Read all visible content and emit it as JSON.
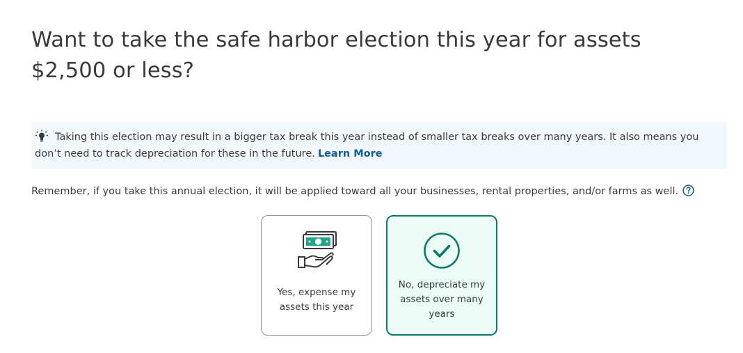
{
  "question": {
    "title": "Want to take the safe harbor election this year for assets $2,500 or less?"
  },
  "tip": {
    "icon": "lightbulb-icon",
    "text": "Taking this election may result in a bigger tax break this year instead of smaller tax breaks over many years. It also means you don’t need to track depreciation for these in the future.",
    "link_label": "Learn More"
  },
  "reminder": {
    "text": "Remember, if you take this annual election, it will be applied toward all your businesses, rental properties, and/or farms as well.",
    "help_icon": "help-circle-icon"
  },
  "choices": [
    {
      "label": "Yes, expense my assets this year",
      "icon": "cash-in-hand-icon",
      "selected": false
    },
    {
      "label": "No, depreciate my assets over many years",
      "icon": "checkmark-circle-icon",
      "selected": true
    }
  ],
  "colors": {
    "text": "#393a3d",
    "link": "#0d5c9b",
    "accent": "#0b7a6b",
    "selected_bg": "#ebfbf6",
    "tip_bg": "#f2f7fc",
    "icon_green": "#21a488"
  }
}
